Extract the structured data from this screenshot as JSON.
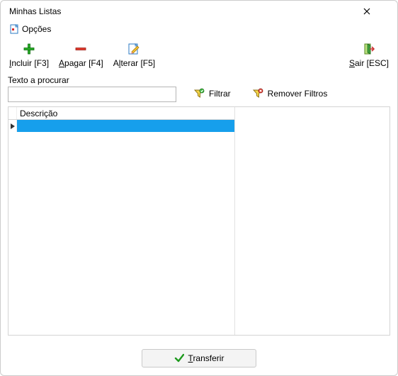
{
  "window": {
    "title": "Minhas Listas"
  },
  "menu": {
    "options": "Opções"
  },
  "toolbar": {
    "include": "Incluir [F3]",
    "delete": "Apagar [F4]",
    "edit": "Alterar [F5]",
    "exit": "Sair [ESC]"
  },
  "filter": {
    "search_label": "Texto a procurar",
    "search_value": "",
    "filter_label": "Filtrar",
    "clear_label": "Remover Filtros"
  },
  "grid": {
    "column_header": "Descrição",
    "rows": [
      {
        "descricao": ""
      }
    ]
  },
  "bottom": {
    "transfer": "Transferir"
  }
}
